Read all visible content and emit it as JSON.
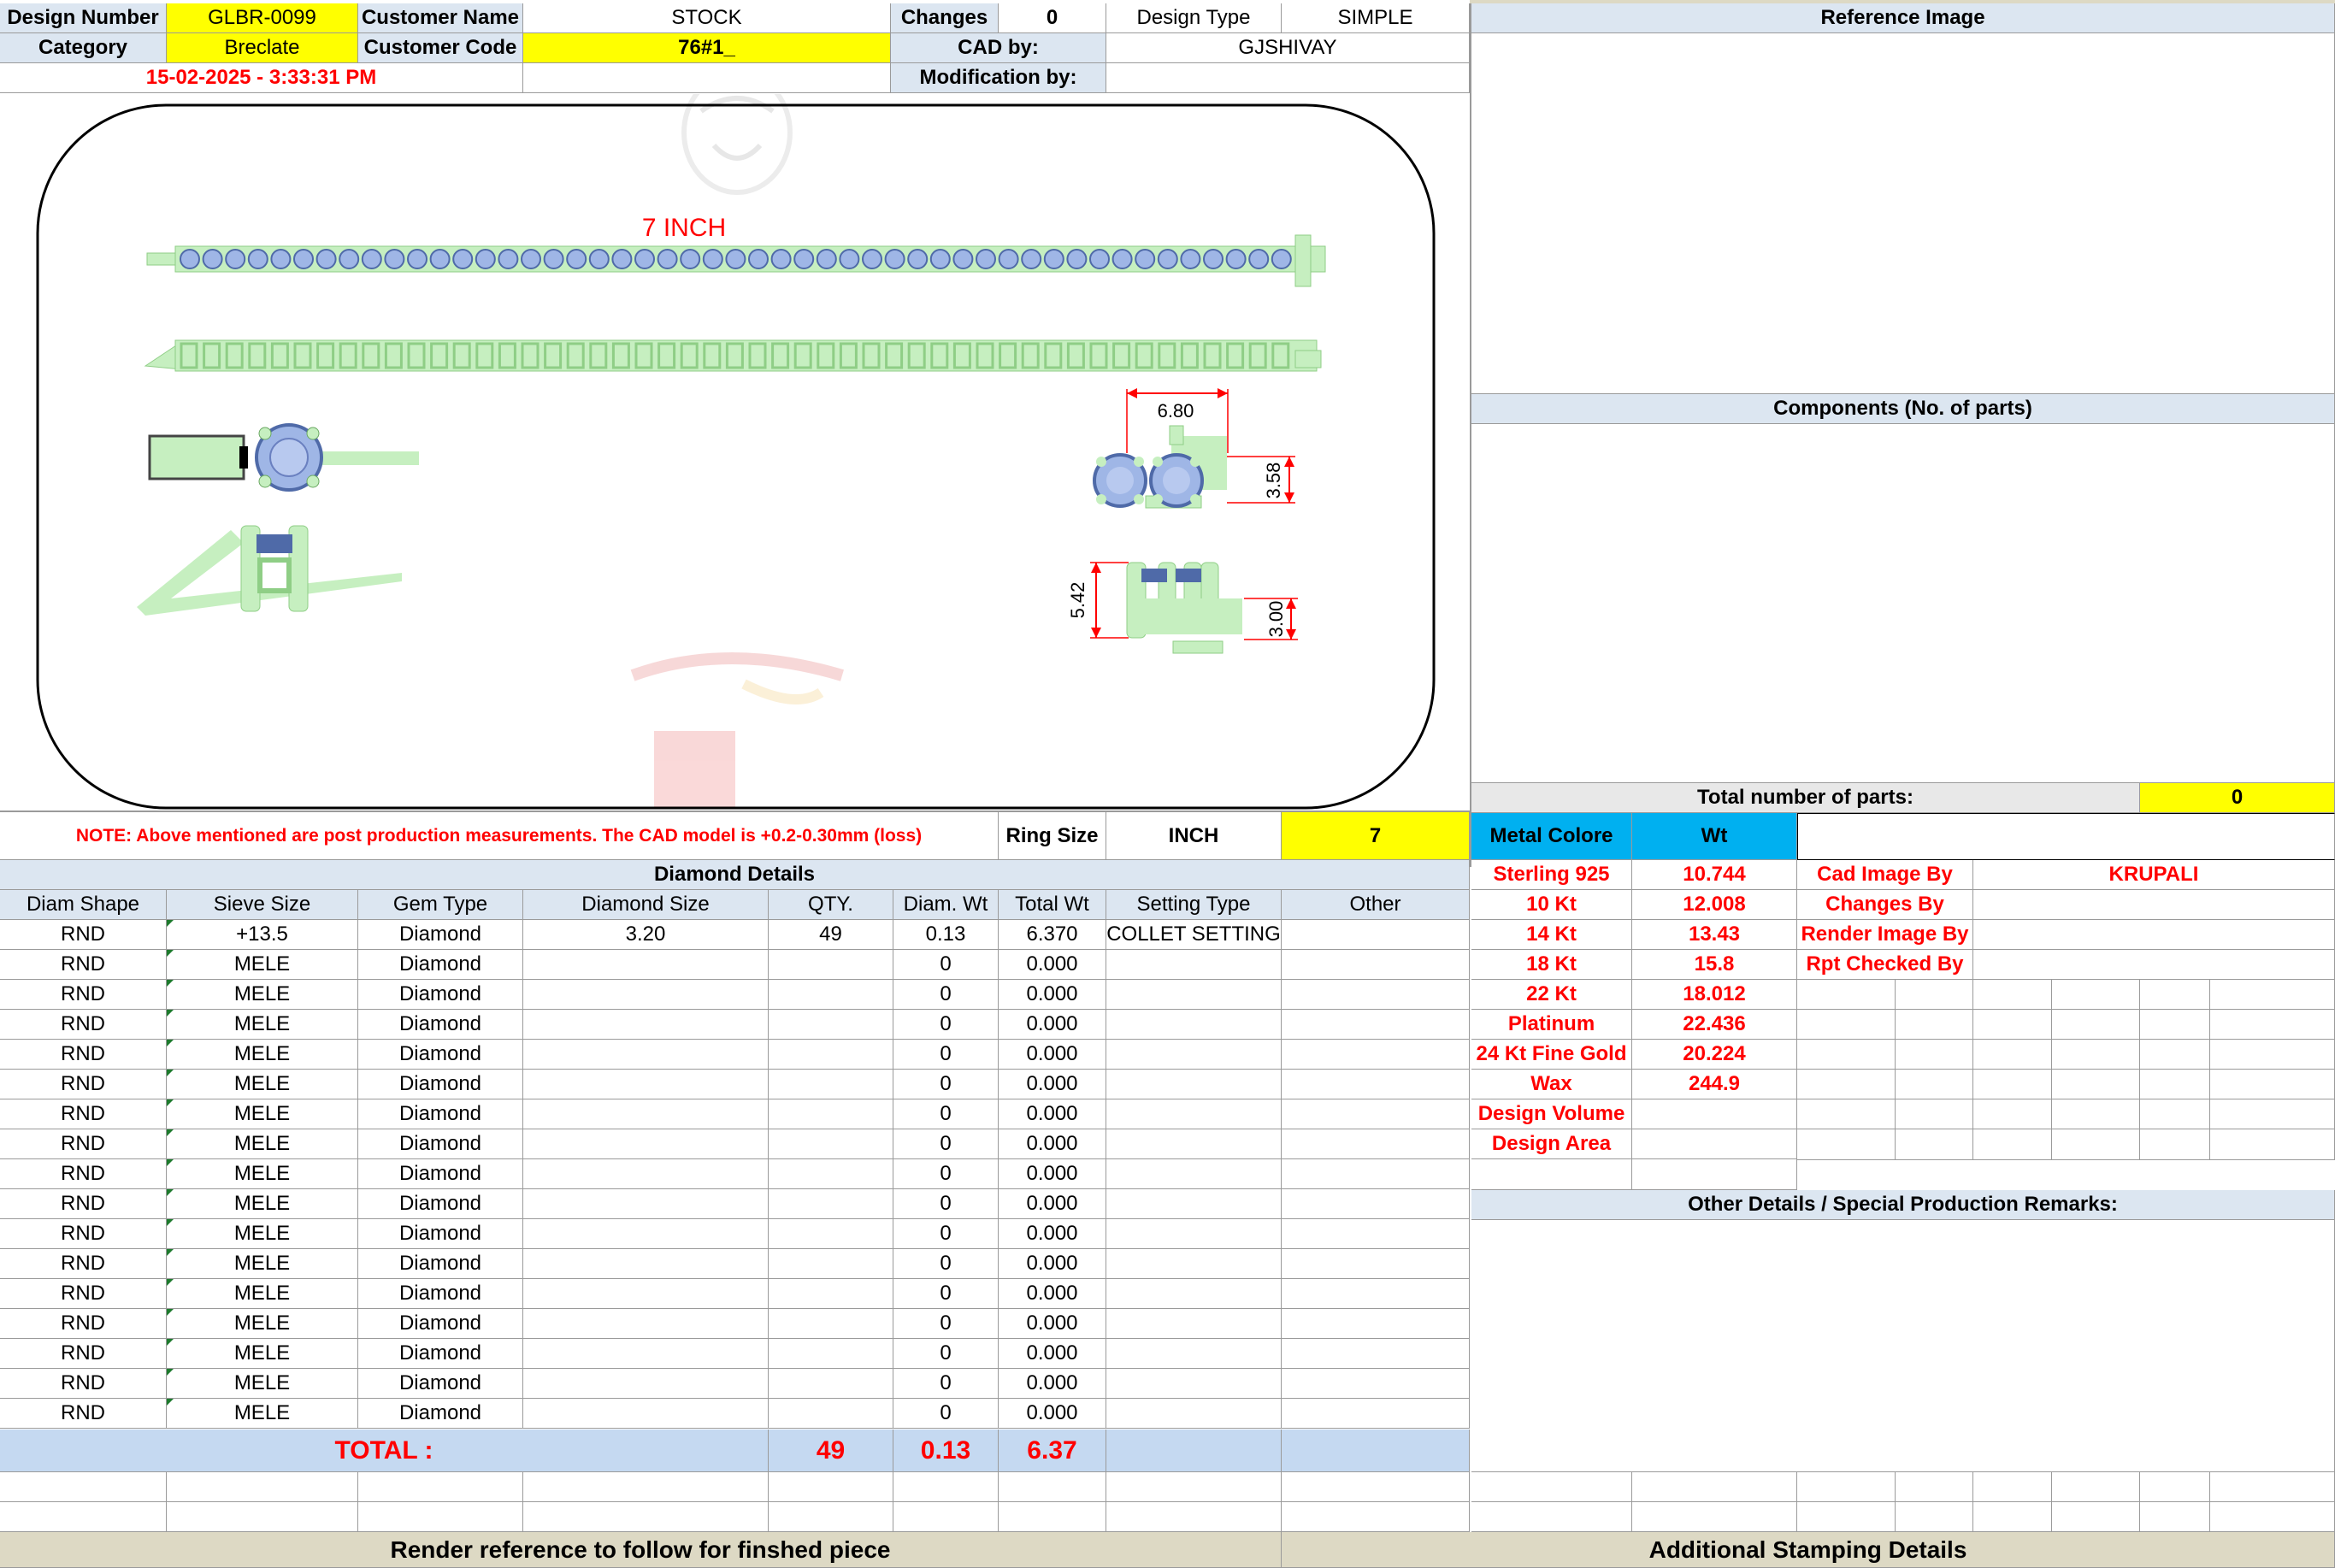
{
  "header": {
    "design_number_label": "Design Number",
    "design_number": "GLBR-0099",
    "customer_name_label": "Customer Name",
    "customer_name": "STOCK",
    "changes_label": "Changes",
    "changes": "0",
    "design_type_label": "Design Type",
    "design_type": "SIMPLE",
    "category_label": "Category",
    "category": "Breclate",
    "customer_code_label": "Customer Code",
    "customer_code": "76#1_",
    "cad_by_label": "CAD by:",
    "cad_by": "GJSHIVAY",
    "timestamp": "15-02-2025 - 3:33:31 PM",
    "modification_by_label": "Modification by:"
  },
  "drawing": {
    "length_label": "7 INCH",
    "dim_width": "6.80",
    "dim_height": "3.58",
    "dim_side_height": "5.42",
    "dim_side_small": "3.00",
    "colors": {
      "metal": "#c6efc0",
      "metal_dark": "#8fce86",
      "stone": "#9fb6e6",
      "stone_dark": "#4f6aa8",
      "dim": "#ff0000"
    }
  },
  "right_panel": {
    "reference_image_title": "Reference Image",
    "components_title": "Components (No. of parts)",
    "total_parts_label": "Total number of parts:",
    "total_parts": "0"
  },
  "note": {
    "text": "NOTE: Above mentioned are post production measurements. The CAD model is +0.2-0.30mm (loss)",
    "ring_size_label": "Ring Size",
    "ring_size_unit": "INCH",
    "ring_size_value": "7",
    "metal_colore_label": "Metal Colore",
    "wt_label": "Wt"
  },
  "diamond_details": {
    "title": "Diamond Details",
    "columns": [
      "Diam Shape",
      "Sieve Size",
      "Gem Type",
      "Diamond Size",
      "QTY.",
      "Diam. Wt",
      "Total Wt",
      "Setting Type",
      "Other"
    ],
    "rows": [
      [
        "RND",
        "+13.5",
        "Diamond",
        "3.20",
        "49",
        "0.13",
        "6.370",
        "COLLET SETTING",
        ""
      ],
      [
        "RND",
        "MELE",
        "Diamond",
        "",
        "",
        "0",
        "0.000",
        "",
        ""
      ],
      [
        "RND",
        "MELE",
        "Diamond",
        "",
        "",
        "0",
        "0.000",
        "",
        ""
      ],
      [
        "RND",
        "MELE",
        "Diamond",
        "",
        "",
        "0",
        "0.000",
        "",
        ""
      ],
      [
        "RND",
        "MELE",
        "Diamond",
        "",
        "",
        "0",
        "0.000",
        "",
        ""
      ],
      [
        "RND",
        "MELE",
        "Diamond",
        "",
        "",
        "0",
        "0.000",
        "",
        ""
      ],
      [
        "RND",
        "MELE",
        "Diamond",
        "",
        "",
        "0",
        "0.000",
        "",
        ""
      ],
      [
        "RND",
        "MELE",
        "Diamond",
        "",
        "",
        "0",
        "0.000",
        "",
        ""
      ],
      [
        "RND",
        "MELE",
        "Diamond",
        "",
        "",
        "0",
        "0.000",
        "",
        ""
      ],
      [
        "RND",
        "MELE",
        "Diamond",
        "",
        "",
        "0",
        "0.000",
        "",
        ""
      ],
      [
        "RND",
        "MELE",
        "Diamond",
        "",
        "",
        "0",
        "0.000",
        "",
        ""
      ],
      [
        "RND",
        "MELE",
        "Diamond",
        "",
        "",
        "0",
        "0.000",
        "",
        ""
      ],
      [
        "RND",
        "MELE",
        "Diamond",
        "",
        "",
        "0",
        "0.000",
        "",
        ""
      ],
      [
        "RND",
        "MELE",
        "Diamond",
        "",
        "",
        "0",
        "0.000",
        "",
        ""
      ],
      [
        "RND",
        "MELE",
        "Diamond",
        "",
        "",
        "0",
        "0.000",
        "",
        ""
      ],
      [
        "RND",
        "MELE",
        "Diamond",
        "",
        "",
        "0",
        "0.000",
        "",
        ""
      ],
      [
        "RND",
        "MELE",
        "Diamond",
        "",
        "",
        "0",
        "0.000",
        "",
        ""
      ]
    ],
    "total_label": "TOTAL :",
    "total_qty": "49",
    "total_diam_wt": "0.13",
    "total_wt": "6.37"
  },
  "metals": [
    {
      "name": "Sterling 925",
      "wt": "10.744"
    },
    {
      "name": "10 Kt",
      "wt": "12.008"
    },
    {
      "name": "14 Kt",
      "wt": "13.43"
    },
    {
      "name": "18 Kt",
      "wt": "15.8"
    },
    {
      "name": "22 Kt",
      "wt": "18.012"
    },
    {
      "name": "Platinum",
      "wt": "22.436"
    },
    {
      "name": "24 Kt Fine Gold",
      "wt": "20.224"
    },
    {
      "name": "Wax",
      "wt": "244.9"
    },
    {
      "name": "Design Volume",
      "wt": ""
    },
    {
      "name": "Design Area",
      "wt": ""
    }
  ],
  "credits": [
    {
      "label": "Cad Image By",
      "value": "KRUPALI"
    },
    {
      "label": "Changes By",
      "value": ""
    },
    {
      "label": "Render Image By",
      "value": ""
    },
    {
      "label": "Rpt Checked By",
      "value": ""
    }
  ],
  "other_details_title": "Other Details / Special Production Remarks:",
  "footer": {
    "render_reference": "Render reference to follow for finshed piece",
    "additional_stamping": "Additional Stamping Details"
  }
}
